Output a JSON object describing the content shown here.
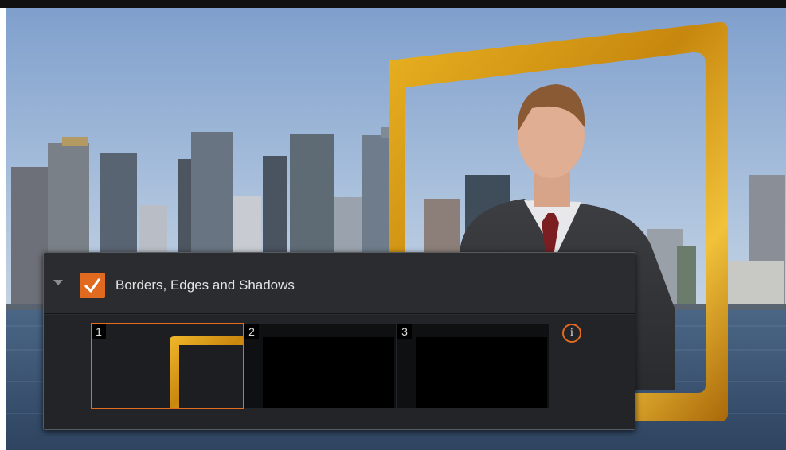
{
  "panel": {
    "header_label": "Borders, Edges and Shadows",
    "enabled": true
  },
  "slots": [
    {
      "number": "1",
      "selected": true
    },
    {
      "number": "2",
      "selected": false
    },
    {
      "number": "3",
      "selected": false
    }
  ],
  "info_icon": {
    "glyph": "i"
  },
  "colors": {
    "accent": "#e06a1f",
    "frame_gold": "#d39a14",
    "panel_bg": "#2b2c2f",
    "sky": "#8fb0d2",
    "water": "#3c5878"
  },
  "icons": [
    "disclosure-triangle-icon",
    "checkmark-icon",
    "info-icon"
  ]
}
